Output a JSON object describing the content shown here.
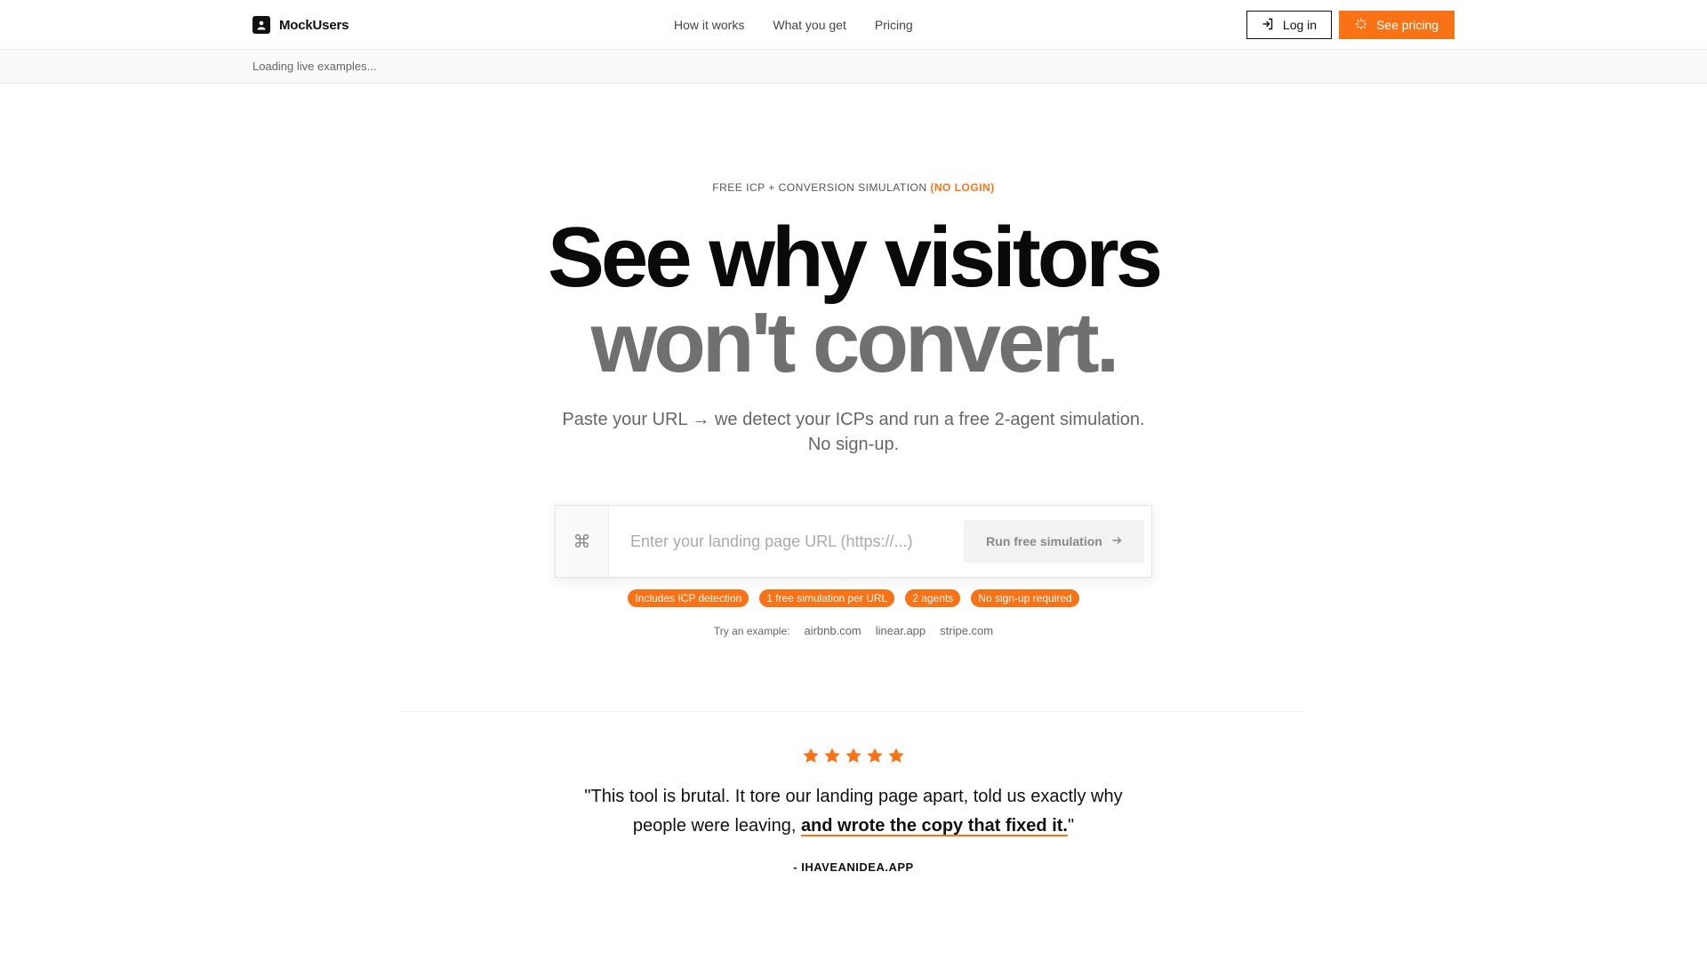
{
  "brand": {
    "name": "MockUsers"
  },
  "nav": {
    "links": [
      "How it works",
      "What you get",
      "Pricing"
    ],
    "login_label": "Log in",
    "pricing_label": "See pricing"
  },
  "subbar": {
    "text": "Loading live examples..."
  },
  "hero": {
    "eyebrow_main": "FREE ICP + CONVERSION SIMULATION",
    "eyebrow_accent": "(NO LOGIN)",
    "headline_line1": "See why visitors",
    "headline_line2": "won't convert.",
    "subtitle_line1": "Paste your URL → we detect your ICPs and run a free 2-agent simulation.",
    "subtitle_line2": "No sign-up."
  },
  "url_form": {
    "placeholder": "Enter your landing page URL (https://...)",
    "value": "",
    "submit_label": "Run free simulation"
  },
  "pills": [
    "Includes ICP detection",
    "1 free simulation per URL",
    "2 agents",
    "No sign-up required"
  ],
  "examples": {
    "label": "Try an example:",
    "links": [
      "airbnb.com",
      "linear.app",
      "stripe.com"
    ]
  },
  "testimonial": {
    "rating": 5,
    "quote_start": "\"This tool is brutal. It tore our landing page apart, told us exactly why people were leaving, ",
    "quote_highlight": "and wrote the copy that fixed it.",
    "quote_end": "\"",
    "author": "- IHAVEANIDEA.APP"
  },
  "colors": {
    "accent": "#f97316",
    "text": "#111111",
    "muted": "#707070"
  }
}
